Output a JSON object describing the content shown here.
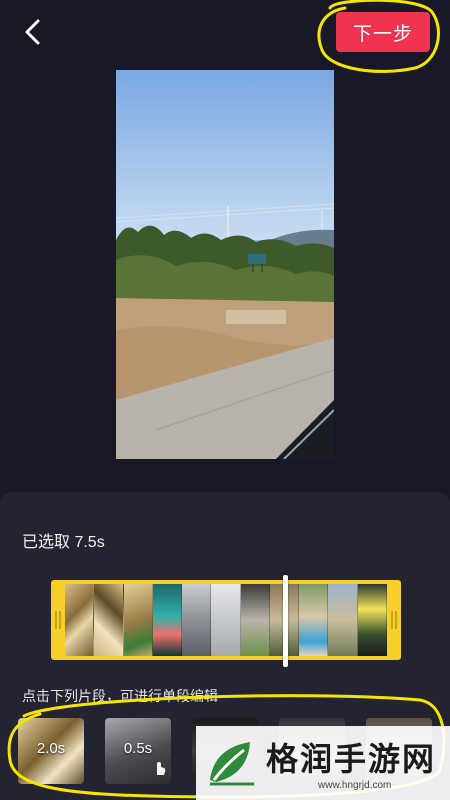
{
  "header": {
    "back_icon": "chevron-left-icon",
    "next_label": "下一步",
    "accent_color": "#f0334e"
  },
  "annotation": {
    "color": "#f5e600"
  },
  "preview": {
    "description": "video-preview"
  },
  "panel": {
    "selected_label": "已选取 7.5s",
    "hint_label": "点击下列片段，可进行单段编辑",
    "strip_color": "#f6cf2a"
  },
  "clips": [
    {
      "duration": "2.0s"
    },
    {
      "duration": "0.5s"
    },
    {
      "duration": ""
    },
    {
      "duration": ""
    },
    {
      "duration": ""
    }
  ],
  "watermark": {
    "title": "格润手游网",
    "url": "www.hngrjd.com"
  }
}
